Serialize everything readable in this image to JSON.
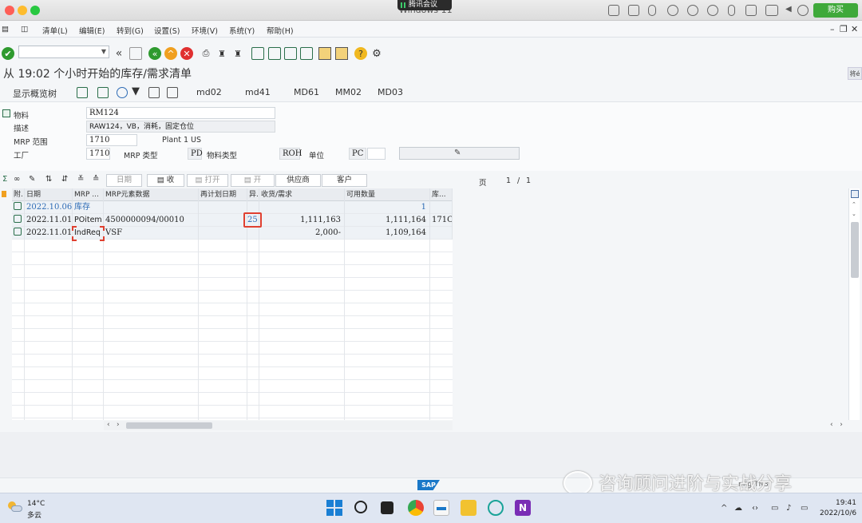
{
  "mac": {
    "title": "Windows 11",
    "meeting": "腾讯会议",
    "buy": "购买"
  },
  "menu": [
    "清单(L)",
    "编辑(E)",
    "转到(G)",
    "设置(S)",
    "环境(V)",
    "系统(Y)",
    "帮助(H)"
  ],
  "page_title": "从 19:02 个小时开始的库存/需求清单",
  "right_tag": "将é",
  "app_toolbar": {
    "tree": "显示概览树",
    "btn1": "md02",
    "btn2": "md41",
    "btn3": "MD61",
    "btn4": "MM02",
    "btn5": "MD03"
  },
  "header": {
    "material_label": "物料",
    "material": "RM124",
    "desc_label": "描述",
    "desc": "RAW124，VB，消耗，固定仓位",
    "mrp_area_label": "MRP 范围",
    "mrp_area": "1710",
    "plant_name": "Plant 1 US",
    "plant_label": "工厂",
    "plant": "1710",
    "mrp_type_label": "MRP 类型",
    "mrp_type": "PD",
    "mat_type_label": "物料类型",
    "mat_type": "ROH",
    "unit_label": "单位",
    "unit": "PC"
  },
  "grid_toolbar": {
    "date": "日期",
    "receipt": "收",
    "open": "打开",
    "open2": "开",
    "vendor": "供应商",
    "customer": "客户"
  },
  "pager": {
    "label": "页",
    "current": "1",
    "sep": "/",
    "total": "1"
  },
  "grid": {
    "columns": [
      "附.",
      "日期",
      "MRP ...",
      "MRP元素数据",
      "再计划日期",
      "异.",
      "收货/需求",
      "可用数量",
      "库..."
    ],
    "rows": [
      {
        "date": "2022.10.06",
        "mrp": "库存",
        "data": "",
        "resched": "",
        "exc": "",
        "qty": "",
        "avail": "1",
        "stor": ""
      },
      {
        "date": "2022.11.01",
        "mrp": "POitem",
        "data": "4500000094/00010",
        "resched": "",
        "exc": "25",
        "qty": "1,111,163",
        "avail": "1,111,164",
        "stor": "171C"
      },
      {
        "date": "2022.11.01",
        "mrp": "IndReq",
        "data": "VSF",
        "resched": "",
        "exc": "",
        "qty": "2,000-",
        "avail": "1,109,164",
        "stor": ""
      }
    ]
  },
  "watermark": "咨询顾问进阶与实战分享",
  "watermark_tail": "nfig  TN3",
  "sap_logo": "SAP",
  "taskbar": {
    "temp": "14°C",
    "weather": "多云",
    "time": "19:41",
    "date": "2022/10/6"
  }
}
